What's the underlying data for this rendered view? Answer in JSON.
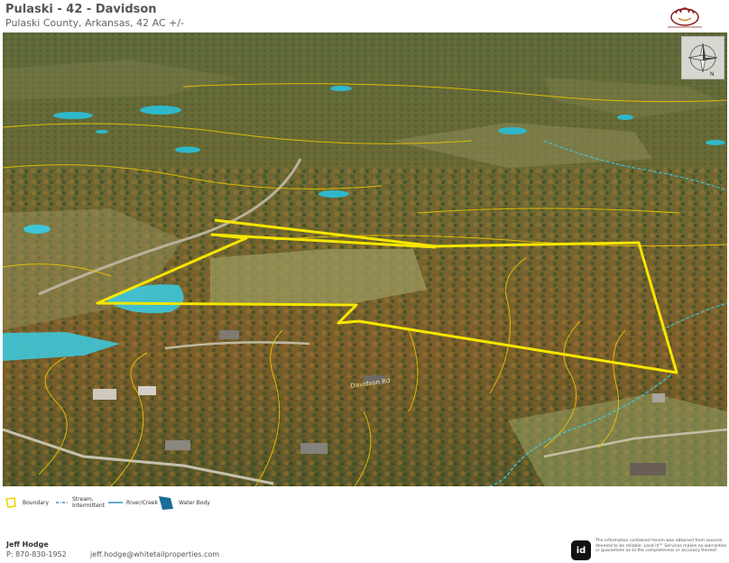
{
  "header": {
    "title": "Pulaski - 42 - Davidson",
    "subtitle": "Pulaski County, Arkansas, 42 AC +/-"
  },
  "map": {
    "view": "3D aerial oblique imagery",
    "boundary_color": "#f5e600",
    "contour_color": "#e8c400",
    "water_color": "#2fc3d6",
    "road_labels": [
      "Davidson Rd"
    ]
  },
  "compass": {
    "icon": "compass-rose-icon",
    "north_label": "N"
  },
  "legend": {
    "items": [
      {
        "label": "Boundary",
        "icon": "boundary-icon"
      },
      {
        "label": "Stream, Intermittent",
        "icon": "stream-intermittent-icon"
      },
      {
        "label": "River/Creek",
        "icon": "river-creek-icon"
      },
      {
        "label": "Water Body",
        "icon": "water-body-icon"
      }
    ]
  },
  "footer": {
    "agent_name": "Jeff Hodge",
    "agent_phone": "P: 870-830-1952",
    "agent_email": "jeff.hodge@whitetailproperties.com",
    "id_logo_text": "id",
    "disclaimer": "The information contained herein was obtained from sources deemed to be reliable. Land id™ Services makes no warranties or guarantees as to the completeness or accuracy thereof."
  }
}
